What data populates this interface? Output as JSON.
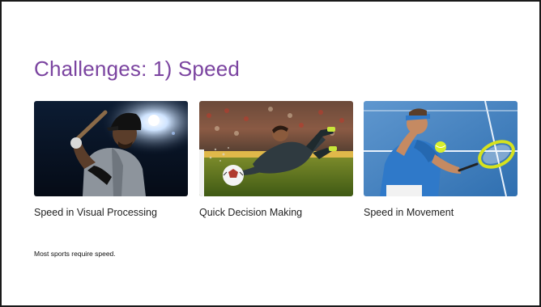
{
  "slide": {
    "title": "Challenges: 1) Speed",
    "title_color": "#7b44a0",
    "cards": [
      {
        "caption": "Speed in Visual Processing",
        "image": "baseball-batter-photo"
      },
      {
        "caption": "Quick Decision Making",
        "image": "soccer-goalkeeper-photo"
      },
      {
        "caption": "Speed in Movement",
        "image": "tennis-player-photo"
      }
    ],
    "note": "Most sports require speed."
  }
}
